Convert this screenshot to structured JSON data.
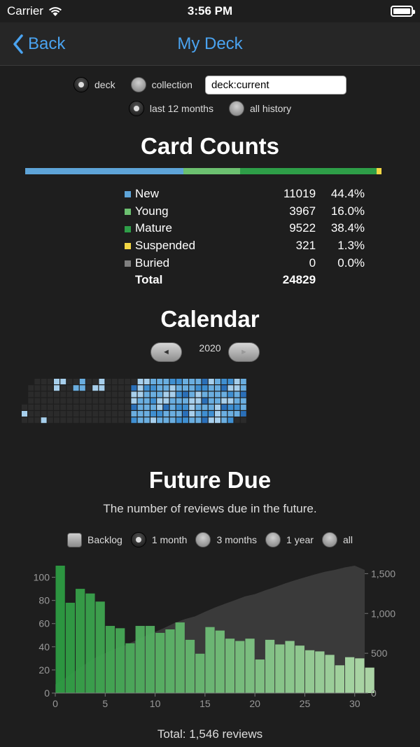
{
  "status": {
    "carrier": "Carrier",
    "time": "3:56 PM"
  },
  "nav": {
    "back_label": "Back",
    "title": "My Deck"
  },
  "filters": {
    "scope_options": [
      "deck",
      "collection"
    ],
    "scope_selected": "deck",
    "search_value": "deck:current",
    "period_options": [
      "last 12 months",
      "all history"
    ],
    "period_selected": "last 12 months"
  },
  "card_counts": {
    "title": "Card Counts",
    "rows": [
      {
        "label": "New",
        "count": "11019",
        "percent": "44.4%",
        "color": "#5ea4d8"
      },
      {
        "label": "Young",
        "count": "3967",
        "percent": "16.0%",
        "color": "#6cc070"
      },
      {
        "label": "Mature",
        "count": "9522",
        "percent": "38.4%",
        "color": "#2e9e48"
      },
      {
        "label": "Suspended",
        "count": "321",
        "percent": "1.3%",
        "color": "#f2d644"
      },
      {
        "label": "Buried",
        "count": "0",
        "percent": "0.0%",
        "color": "#808080"
      }
    ],
    "total_label": "Total",
    "total_value": "24829"
  },
  "calendar": {
    "title": "Calendar",
    "year": "2020",
    "prev_symbol": "◄",
    "next_symbol": "►"
  },
  "future_due": {
    "title": "Future Due",
    "subtitle": "The number of reviews due in the future.",
    "backlog_label": "Backlog",
    "backlog_checked": false,
    "range_options": [
      "1 month",
      "3 months",
      "1 year",
      "all"
    ],
    "range_selected": "1 month",
    "total_text": "Total: 1,546 reviews"
  },
  "chart_data": {
    "type": "bar",
    "x": [
      0,
      1,
      2,
      3,
      4,
      5,
      6,
      7,
      8,
      9,
      10,
      11,
      12,
      13,
      14,
      15,
      16,
      17,
      18,
      19,
      20,
      21,
      22,
      23,
      24,
      25,
      26,
      27,
      28,
      29,
      30
    ],
    "values": [
      110,
      78,
      90,
      86,
      79,
      58,
      56,
      43,
      58,
      58,
      52,
      55,
      61,
      46,
      34,
      57,
      54,
      47,
      45,
      47,
      29,
      46,
      42,
      45,
      41,
      37,
      36,
      33,
      24,
      31,
      30,
      22
    ],
    "x_full": [
      0,
      1,
      2,
      3,
      4,
      5,
      6,
      7,
      8,
      9,
      10,
      11,
      12,
      13,
      14,
      15,
      16,
      17,
      18,
      19,
      20,
      21,
      22,
      23,
      24,
      25,
      26,
      27,
      28,
      29,
      30,
      31
    ],
    "cumulative_values": [
      110,
      188,
      278,
      364,
      443,
      501,
      557,
      600,
      658,
      716,
      768,
      823,
      884,
      930,
      964,
      1021,
      1075,
      1122,
      1167,
      1214,
      1243,
      1289,
      1331,
      1376,
      1417,
      1454,
      1490,
      1523,
      1547,
      1578,
      1608,
      1546
    ],
    "xlim": [
      0,
      31
    ],
    "ylim": [
      0,
      110
    ],
    "y2lim": [
      0,
      1600
    ],
    "x_ticks": [
      0,
      5,
      10,
      15,
      20,
      25,
      30
    ],
    "y_ticks": [
      0,
      20,
      40,
      60,
      80,
      100
    ],
    "y2_ticks": [
      "0",
      "500",
      "1,000",
      "1,500"
    ],
    "y2_tick_values": [
      0,
      500,
      1000,
      1500
    ],
    "bar_color_start": "#2ea043",
    "bar_color_end": "#b6e3b0",
    "cumulative_color": "#3a3a3a",
    "grid": false
  },
  "heatmap_colors": [
    "#2b2b2b",
    "#a7cfec",
    "#6aaee0",
    "#3f8fd1",
    "#2a6fb8"
  ]
}
